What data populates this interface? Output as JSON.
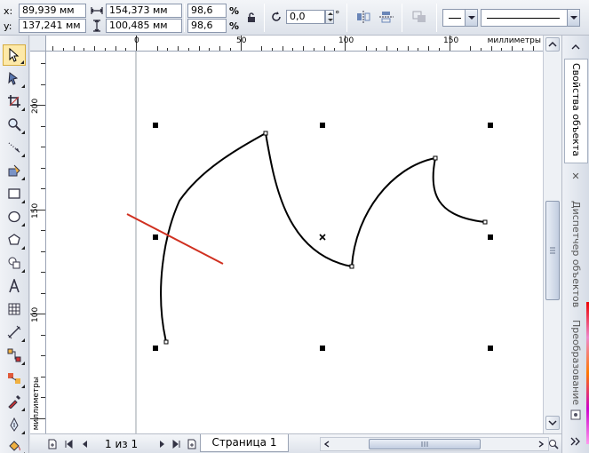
{
  "propbar": {
    "x_label": "x:",
    "x_value": "89,939 мм",
    "y_label": "y:",
    "y_value": "137,241 мм",
    "width_value": "154,373 мм",
    "height_value": "100,485 мм",
    "scale_x": "98,6",
    "scale_y": "98,6",
    "percent_x": "%",
    "percent_y": "%",
    "rotation_value": "0,0",
    "rotation_unit": "°"
  },
  "rulers": {
    "unit": "миллиметры",
    "h_labels": [
      "0",
      "50",
      "100",
      "150"
    ],
    "v_labels": [
      "200",
      "150",
      "100"
    ]
  },
  "docker": {
    "tab1": "Свойства объекта",
    "tab2": "Диспетчер объектов",
    "tab3": "Преобразование",
    "close": "✕"
  },
  "statusbar": {
    "page_count": "1 из 1",
    "page_tab": "Страница 1"
  },
  "colors": {
    "accent_line": "#d03020",
    "curve": "#000000",
    "selected_tool_bg": "#fde9a8"
  },
  "icons": {
    "lock": "lock-icon",
    "rotate": "rotate-icon",
    "pick_tool": "pick-tool-icon"
  }
}
